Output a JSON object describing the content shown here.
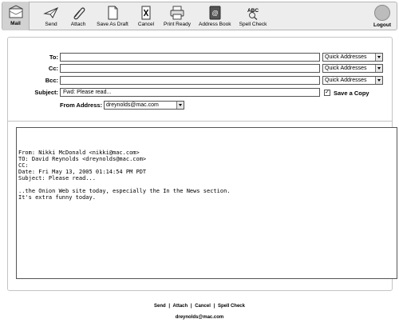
{
  "toolbar": {
    "mail": "Mail",
    "send": "Send",
    "attach": "Attach",
    "save_draft": "Save As Draft",
    "cancel": "Cancel",
    "print_ready": "Print Ready",
    "address_book": "Address Book",
    "spell_check": "Spell Check",
    "logout": "Logout",
    "icons": [
      "mailbox-icon",
      "paper-plane-icon",
      "paperclip-icon",
      "document-icon",
      "x-document-icon",
      "printer-icon",
      "address-book-icon",
      "spell-check-icon",
      "logout-icon"
    ]
  },
  "compose": {
    "to_label": "To:",
    "cc_label": "Cc:",
    "bcc_label": "Bcc:",
    "subject_label": "Subject:",
    "to_value": "",
    "cc_value": "",
    "bcc_value": "",
    "subject_value": "Fwd: Please read...",
    "quick_addresses": "Quick Addresses",
    "save_copy_label": "Save a Copy",
    "save_copy_checked": true,
    "from_label": "From Address:",
    "from_value": "dreynolds@mac.com",
    "body": "From: Nikki McDonald <nikki@mac.com>\nTO: David Reynolds <dreynolds@mac.com>\nCC:\nDate: Fri May 13, 2005 01:14:54 PM PDT\nSubject: Please read...\n\n..the Onion Web site today, especially the In the News section.\nIt's extra funny today."
  },
  "footer": {
    "send": "Send",
    "attach": "Attach",
    "cancel": "Cancel",
    "spell_check": "Spell Check",
    "separator": "|",
    "user": "dreynolds@mac.com"
  }
}
